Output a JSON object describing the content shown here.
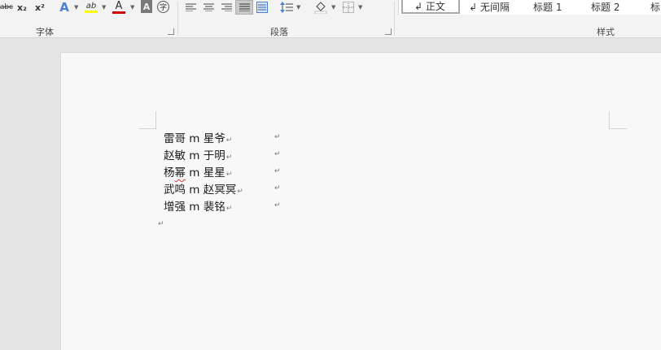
{
  "ribbon": {
    "font_group": {
      "label": "字体",
      "buttons": [
        {
          "name": "strikethrough-button",
          "text": "abc"
        },
        {
          "name": "subscript-button",
          "text": "x₂"
        },
        {
          "name": "superscript-button",
          "text": "x²"
        },
        {
          "name": "text-effects-button",
          "text": "A"
        },
        {
          "name": "highlight-button",
          "text": "ab"
        },
        {
          "name": "font-color-button",
          "text": "A"
        },
        {
          "name": "char-shading-button",
          "text": "A"
        },
        {
          "name": "enclose-char-button",
          "text": "字"
        }
      ],
      "colors": {
        "highlight": "#ffff00",
        "font_color": "#d00000",
        "effects": "#4a7fd6"
      }
    },
    "paragraph_group": {
      "label": "段落"
    },
    "styles_group": {
      "label": "样式",
      "items": [
        "↲ 正文",
        "↲ 无间隔",
        "标题 1",
        "标题 2",
        "标"
      ]
    }
  },
  "document": {
    "lines": [
      {
        "text": "雷哥 m 星爷",
        "mark": "↵"
      },
      {
        "text": "赵敏 m 于明",
        "mark": "↵"
      },
      {
        "text_pre": "杨",
        "text_err": "幂",
        "text_post": " m 星星",
        "mark": "↵"
      },
      {
        "text": "武鸣 m 赵冥冥",
        "mark": "↵"
      },
      {
        "text": "增强 m 裴铭",
        "mark": "↵"
      }
    ],
    "cell_mark": "↵",
    "end_mark": "↵"
  }
}
